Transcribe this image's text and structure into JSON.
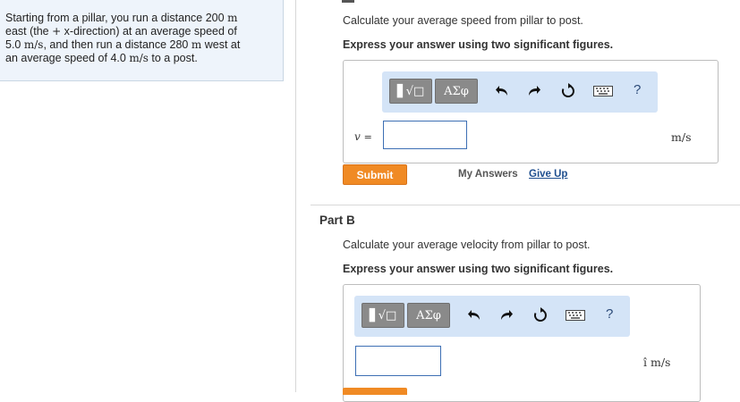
{
  "problem": {
    "line1_pre": "Starting from a pillar, you run a distance 200 ",
    "line1_unit": "m",
    "line2_pre": "east (the ",
    "line2_plus": "+",
    "line2_post": " x-direction) at an average speed of",
    "line3_val": "5.0 ",
    "line3_unit": "m/s",
    "line3_post": ", and then run a distance 280 ",
    "line3_unit2": "m",
    "line3_post2": " west at",
    "line4_pre": "an average speed of 4.0 ",
    "line4_unit": "m/s",
    "line4_post": " to a post."
  },
  "partA": {
    "question": "Calculate your average speed from pillar to post.",
    "instruction": "Express your answer using two significant figures.",
    "toolbar": {
      "template_label": "▋√□",
      "greek_label": "ΑΣφ",
      "help_label": "?"
    },
    "variable": "v",
    "equals": "=",
    "input_value": "",
    "unit": "m/s",
    "submit_label": "Submit",
    "my_answers_label": "My Answers",
    "give_up_label": "Give Up"
  },
  "partB": {
    "title": "Part B",
    "question": "Calculate your average velocity from pillar to post.",
    "instruction": "Express your answer using two significant figures.",
    "toolbar": {
      "template_label": "▋√□",
      "greek_label": "ΑΣφ",
      "help_label": "?"
    },
    "input_value": "",
    "unit_vector": "î",
    "unit": "m/s"
  }
}
